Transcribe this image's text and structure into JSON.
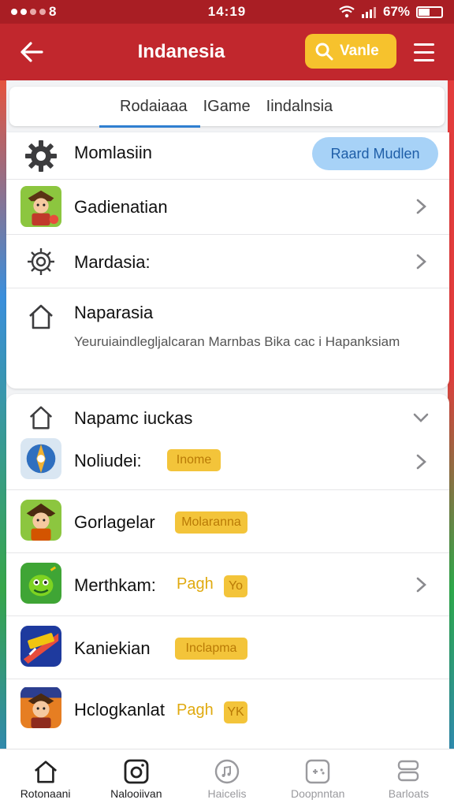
{
  "status": {
    "time": "14:19",
    "battery": "67%",
    "carrier": "8"
  },
  "header": {
    "title": "Indanesia",
    "action_label": "Vanle"
  },
  "tabs": [
    {
      "label": "Rodaiaaa",
      "active": true
    },
    {
      "label": "IGame",
      "active": false
    },
    {
      "label": "Iindalnsia",
      "active": false
    }
  ],
  "settings": {
    "items": [
      {
        "label": "Momlasiin",
        "icon": "gear-icon",
        "button": "Raard Mudlen"
      },
      {
        "label": "Gadienatian",
        "icon": "game-avatar-icon"
      },
      {
        "label": "Mardasia:",
        "icon": "gear-outline-icon"
      },
      {
        "label": "Naparasia",
        "icon": "home-icon"
      }
    ],
    "description": "Yeuruiaindlegljalcaran Marnbas Bika cac i Hapanksiam"
  },
  "games": {
    "section_title": "Napamc iuckas",
    "items": [
      {
        "name": "Noliudei:",
        "tag": "Inome",
        "icon": "compass-game-icon"
      },
      {
        "name": "Gorlagelar",
        "tag": "Molaranna",
        "icon": "warrior-game-icon"
      },
      {
        "name": "Merthkam:",
        "tag_text": "Pagh",
        "tag": "Yo",
        "icon": "monster-game-icon"
      },
      {
        "name": "Kaniekian",
        "tag": "Inclapma",
        "icon": "racing-game-icon"
      },
      {
        "name": "Hclogkanlat",
        "tag_text": "Pagh",
        "tag": "YK",
        "icon": "hero-game-icon"
      }
    ]
  },
  "bottom_nav": [
    {
      "label": "Rotonaani",
      "icon": "home-icon",
      "active": true
    },
    {
      "label": "Nalooiivan",
      "icon": "camera-icon",
      "active": true
    },
    {
      "label": "Haicelis",
      "icon": "music-icon",
      "active": false
    },
    {
      "label": "Doopnntan",
      "icon": "gamepad-icon",
      "active": false
    },
    {
      "label": "Barloats",
      "icon": "stack-icon",
      "active": false
    }
  ]
}
